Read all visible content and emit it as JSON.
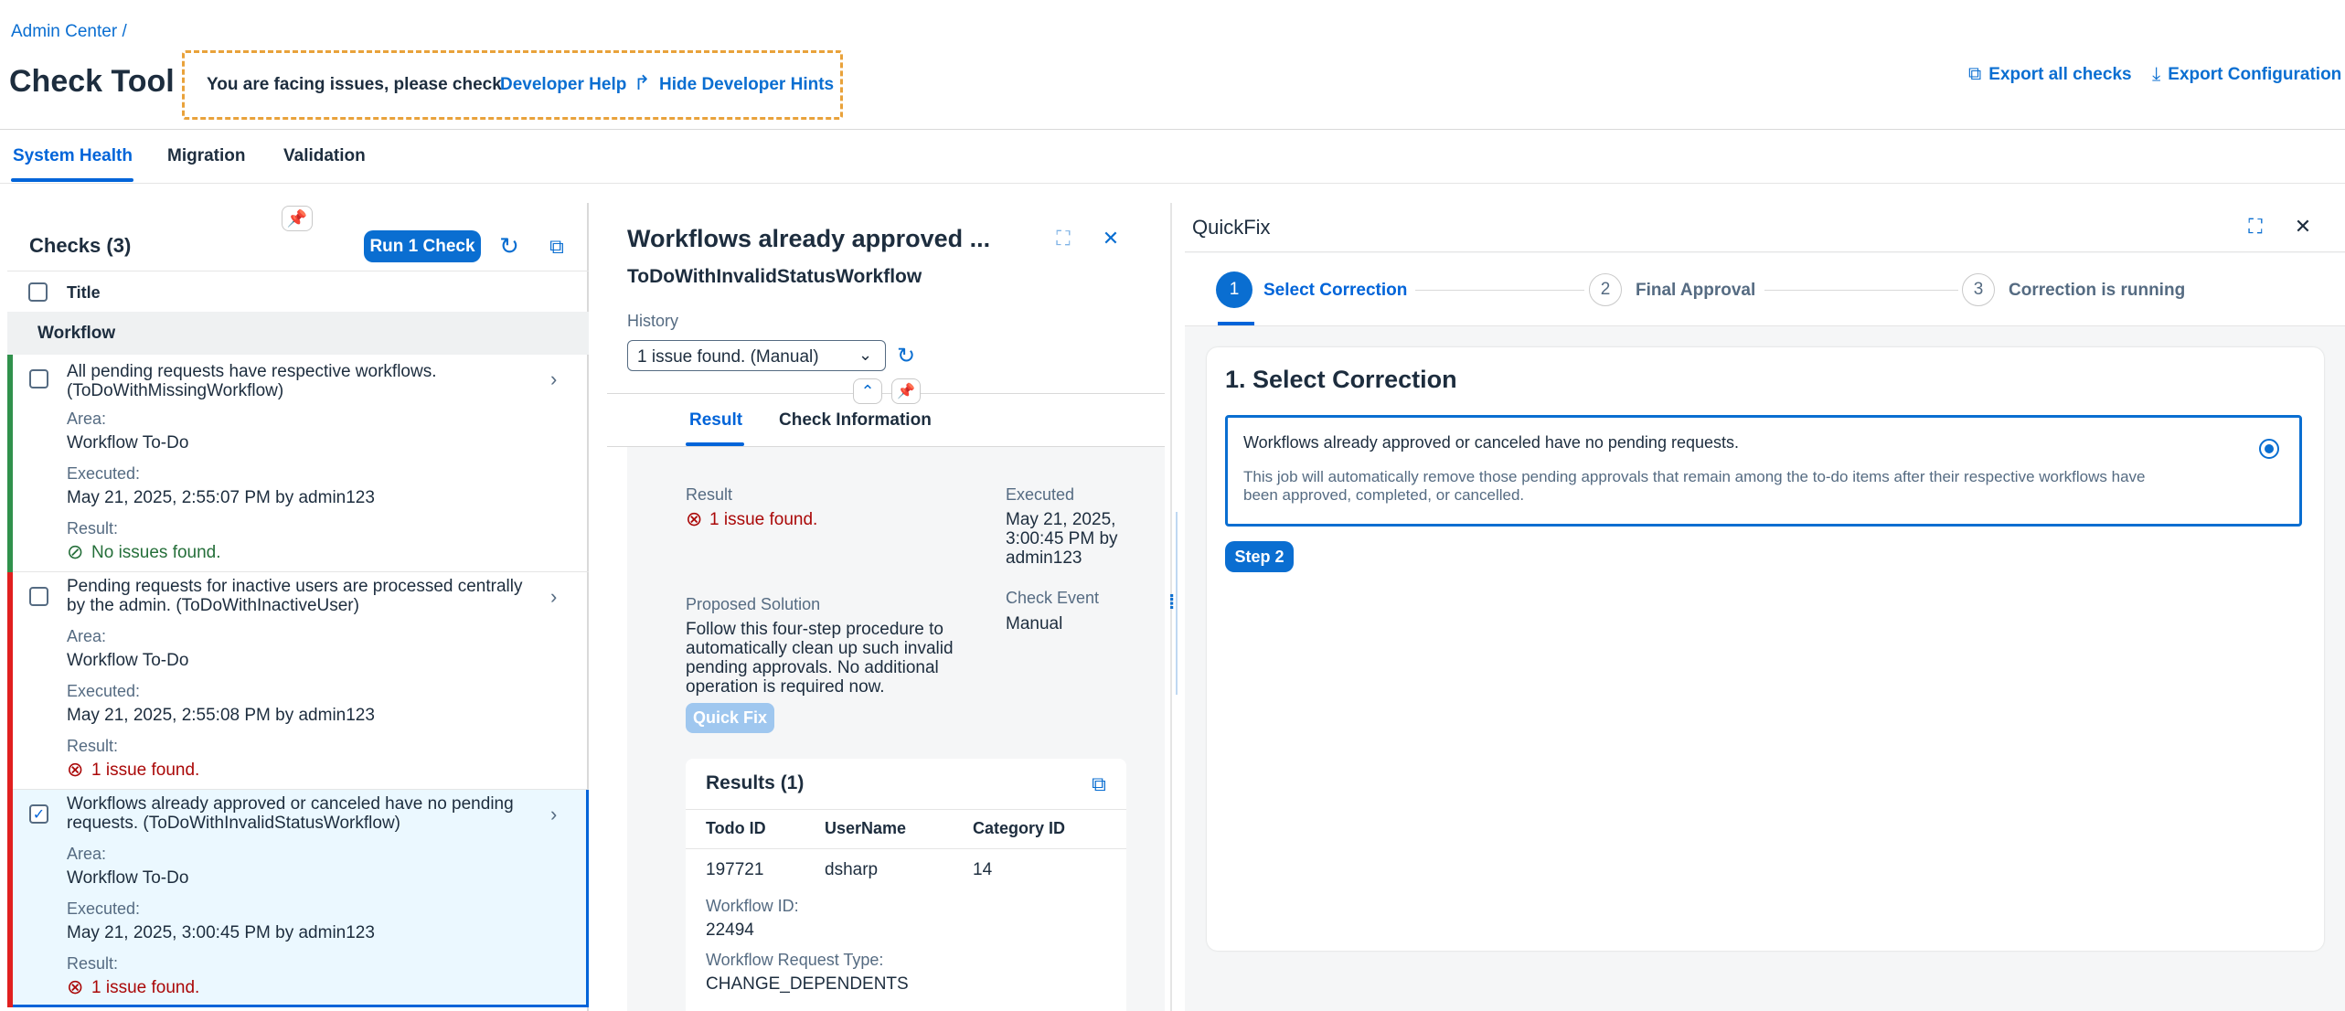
{
  "breadcrumb": "Admin Center /",
  "app_title": "Check Tool",
  "dev_hint": {
    "text": "You are facing issues, please check",
    "help_link": "Developer Help",
    "hide_link": "Hide Developer Hints"
  },
  "header_actions": {
    "export_all": "Export all checks",
    "export_config": "Export Configuration"
  },
  "tabs": [
    {
      "label": "System Health",
      "selected": true
    },
    {
      "label": "Migration",
      "selected": false
    },
    {
      "label": "Validation",
      "selected": false
    }
  ],
  "checks_panel": {
    "title": "Checks (3)",
    "run_button": "Run 1 Check",
    "col_title": "Title",
    "group": "Workflow",
    "items": [
      {
        "title_line1": "All pending requests have respective workflows.",
        "title_line2": "(ToDoWithMissingWorkflow)",
        "area_label": "Area:",
        "area": "Workflow To-Do",
        "executed_label": "Executed:",
        "executed": "May 21, 2025, 2:55:07 PM by admin123",
        "result_label": "Result:",
        "result": "No issues found.",
        "status": "success"
      },
      {
        "title_line1": "Pending requests for inactive users are processed centrally",
        "title_line2": "by the admin. (ToDoWithInactiveUser)",
        "area_label": "Area:",
        "area": "Workflow To-Do",
        "executed_label": "Executed:",
        "executed": "May 21, 2025, 2:55:08 PM by admin123",
        "result_label": "Result:",
        "result": "1 issue found.",
        "status": "error"
      },
      {
        "title_line1": "Workflows already approved or canceled have no pending",
        "title_line2": "requests. (ToDoWithInvalidStatusWorkflow)",
        "area_label": "Area:",
        "area": "Workflow To-Do",
        "executed_label": "Executed:",
        "executed": "May 21, 2025, 3:00:45 PM by admin123",
        "result_label": "Result:",
        "result": "1 issue found.",
        "status": "error"
      }
    ]
  },
  "detail": {
    "title": "Workflows already approved ...",
    "subtitle": "ToDoWithInvalidStatusWorkflow",
    "history_label": "History",
    "history_value": "1 issue found. (Manual)",
    "tabs": [
      "Result",
      "Check Information"
    ],
    "result_label": "Result",
    "result_value": "1 issue found.",
    "executed_label": "Executed",
    "executed_lines": [
      "May 21, 2025,",
      "3:00:45 PM by",
      "admin123"
    ],
    "proposed_label": "Proposed Solution",
    "proposed_lines": [
      "Follow this four-step procedure to",
      "automatically clean up such invalid",
      "pending approvals. No additional",
      "operation is required now."
    ],
    "check_event_label": "Check Event",
    "check_event_value": "Manual",
    "quick_fix_button": "Quick Fix",
    "results_title": "Results (1)",
    "results_columns": [
      "Todo ID",
      "UserName",
      "Category ID"
    ],
    "results_row": {
      "todo_id": "197721",
      "username": "dsharp",
      "category_id": "14"
    },
    "workflow_id_label": "Workflow ID:",
    "workflow_id": "22494",
    "request_type_label": "Workflow Request Type:",
    "request_type": "CHANGE_DEPENDENTS"
  },
  "quickfix": {
    "title": "QuickFix",
    "steps": [
      {
        "num": "1",
        "label": "Select Correction"
      },
      {
        "num": "2",
        "label": "Final Approval"
      },
      {
        "num": "3",
        "label": "Correction is running"
      }
    ],
    "section_title": "1. Select Correction",
    "option_title": "Workflows already approved or canceled have no pending requests.",
    "option_desc_line1": "This job will automatically remove those pending approvals that remain among the to-do items after their respective workflows have",
    "option_desc_line2": "been approved, completed, or cancelled.",
    "step2_button": "Step 2"
  },
  "colors": {
    "accent": "#0a6ed1",
    "success": "#256f3a",
    "error": "#aa0808",
    "dev_border": "#e9a23b"
  }
}
